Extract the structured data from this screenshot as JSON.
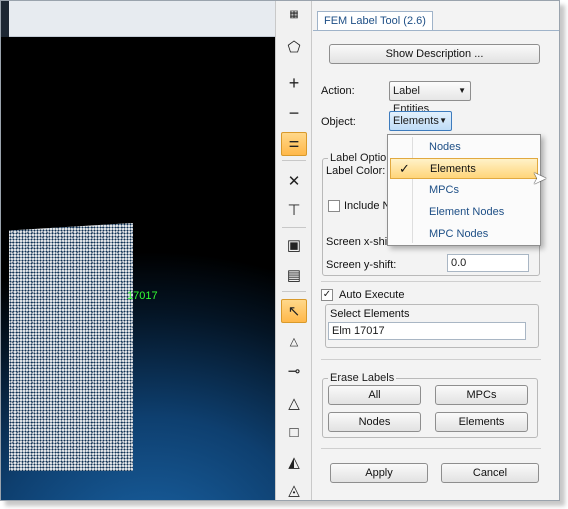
{
  "viewport": {
    "element_label": "17017"
  },
  "toolbar": {
    "icons": [
      "select-region-icon",
      "zoom-in-icon",
      "zoom-out-icon",
      "equal-icon",
      "erase-icon",
      "filter-icon",
      "move-icon",
      "copy-icon",
      "pointer-icon",
      "point-icon",
      "line-icon",
      "tria-icon",
      "quad-icon",
      "tetra-icon",
      "hexa-icon"
    ],
    "glyphs": {
      "select": "⬠",
      "plus": "+",
      "minus": "−",
      "equal": "=",
      "cross": "✕",
      "filter": "⊤",
      "move": "▣",
      "copy": "▤",
      "pointer": "↖",
      "point": "△",
      "line": "⊸",
      "tria": "△",
      "quad": "□",
      "tetra": "◭",
      "hexa": "◬"
    }
  },
  "panel": {
    "tab_title": "FEM Label Tool (2.6)",
    "show_description": "Show Description ...",
    "action_label": "Action:",
    "action_value": "Label Entities",
    "object_label": "Object:",
    "object_value": "Elements",
    "label_options_title": "Label Options",
    "label_color_label": "Label Color:",
    "include_label": "Include N",
    "screen_x_label": "Screen x-shift:",
    "screen_y_label": "Screen y-shift:",
    "screen_y_value": "0.0",
    "auto_execute": "Auto Execute",
    "auto_execute_checked": true,
    "select_elements_title": "Select Elements",
    "select_elements_value": "Elm 17017",
    "erase_labels_title": "Erase Labels",
    "erase_all": "All",
    "erase_mpcs": "MPCs",
    "erase_nodes": "Nodes",
    "erase_elements": "Elements",
    "apply": "Apply",
    "cancel": "Cancel"
  },
  "object_dropdown": {
    "items": [
      "Nodes",
      "Elements",
      "MPCs",
      "Element Nodes",
      "MPC Nodes"
    ],
    "selected": "Elements",
    "check": "✓"
  },
  "colors": {
    "accent": "#ffd57a",
    "link": "#1e4f86",
    "label_green": "#33ff33"
  }
}
